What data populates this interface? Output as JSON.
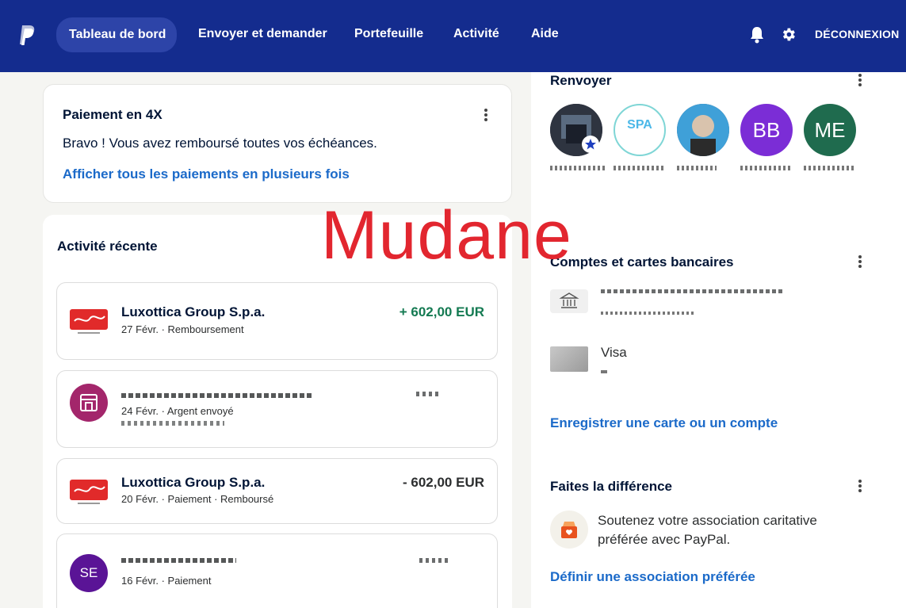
{
  "nav": {
    "items": [
      "Tableau de bord",
      "Envoyer et demander",
      "Portefeuille",
      "Activité",
      "Aide"
    ],
    "logout": "DÉCONNEXION"
  },
  "pay4x": {
    "title": "Paiement en 4X",
    "message": "Bravo ! Vous avez remboursé toutes vos échéances.",
    "link": "Afficher tous les paiements en plusieurs fois"
  },
  "activity": {
    "title": "Activité récente",
    "transactions": [
      {
        "name": "Luxottica Group S.p.a.",
        "date": "27 Févr.",
        "type": "Remboursement",
        "status": "",
        "amount": "+ 602,00 EUR",
        "avatar": "RayBan"
      },
      {
        "name": "",
        "date": "24 Févr.",
        "type": "Argent envoyé",
        "status": "",
        "amount": "",
        "avatar": "store"
      },
      {
        "name": "Luxottica Group S.p.a.",
        "date": "20 Févr.",
        "type": "Paiement",
        "status": "Remboursé",
        "amount": "- 602,00 EUR",
        "avatar": "RayBan"
      },
      {
        "name": "",
        "date": "16 Févr.",
        "type": "Paiement",
        "status": "",
        "amount": "",
        "avatar": "SE"
      }
    ]
  },
  "watermark": "Mudane",
  "resend": {
    "title": "Renvoyer",
    "contacts": [
      {
        "initials": "",
        "color": "#3b3f4a"
      },
      {
        "initials": "SPA",
        "color": "#ffffff"
      },
      {
        "initials": "",
        "color": "#4a5b6e"
      },
      {
        "initials": "BB",
        "color": "#7b2dd6"
      },
      {
        "initials": "ME",
        "color": "#1f6b4e"
      }
    ]
  },
  "accounts": {
    "title": "Comptes et cartes bancaires",
    "card_label": "Visa",
    "link": "Enregistrer une carte ou un compte"
  },
  "charity": {
    "title": "Faites la différence",
    "text": "Soutenez votre association caritative préférée avec PayPal.",
    "link": "Définir une association préférée"
  },
  "colors": {
    "nav_bg": "#142c8e",
    "link": "#1b6ac9",
    "positive": "#147a52",
    "watermark": "#e2262f"
  }
}
